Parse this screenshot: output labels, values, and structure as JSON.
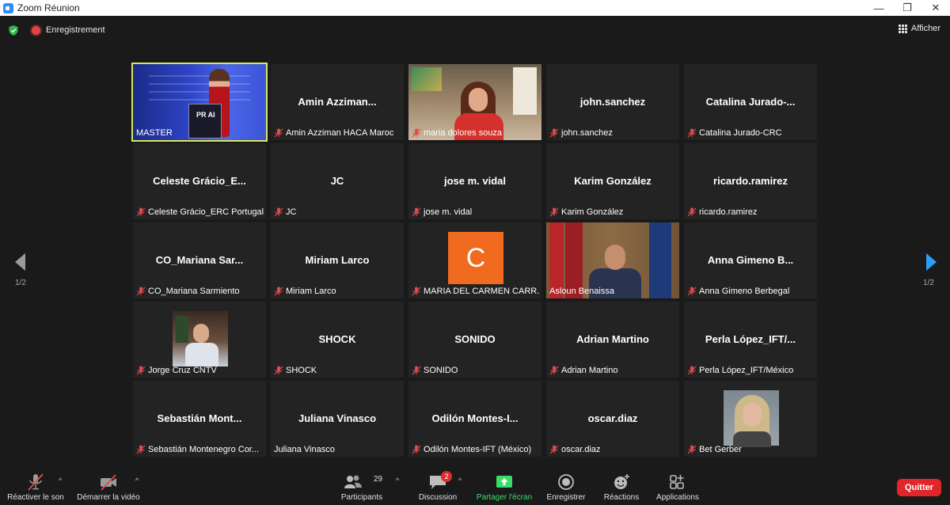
{
  "window": {
    "title": "Zoom Réunion",
    "controls": [
      "—",
      "❐",
      "✕"
    ]
  },
  "topbar": {
    "recording_label": "Enregistrement",
    "view_label": "Afficher"
  },
  "gallery": {
    "page_indicator_left": "1/2",
    "page_indicator_right": "1/2",
    "tiles": [
      {
        "big": "",
        "caption": "MASTER"
      },
      {
        "big": "Amin  Azziman...",
        "caption": "Amin Azziman HACA Maroc"
      },
      {
        "big": "",
        "caption": "maria dolores souza"
      },
      {
        "big": "john.sanchez",
        "caption": "john.sanchez"
      },
      {
        "big": "Catalina  Jurado-...",
        "caption": "Catalina Jurado-CRC"
      },
      {
        "big": "Celeste  Grácio_E...",
        "caption": "Celeste Grácio_ERC Portugal"
      },
      {
        "big": "JC",
        "caption": "JC"
      },
      {
        "big": "jose m. vidal",
        "caption": "jose m. vidal"
      },
      {
        "big": "Karim González",
        "caption": "Karim González"
      },
      {
        "big": "ricardo.ramirez",
        "caption": "ricardo.ramirez"
      },
      {
        "big": "CO_Mariana  Sar...",
        "caption": "CO_Mariana Sarmiento"
      },
      {
        "big": "Miriam Larco",
        "caption": "Miriam Larco"
      },
      {
        "big": "",
        "caption": "MARIA DEL CARMEN CARR..."
      },
      {
        "big": "",
        "caption": "Asloun Benaissa"
      },
      {
        "big": "Anna Gimeno B...",
        "caption": "Anna Gimeno Berbegal"
      },
      {
        "big": "",
        "caption": "Jorge Cruz CNTV"
      },
      {
        "big": "SHOCK",
        "caption": "SHOCK"
      },
      {
        "big": "SONIDO",
        "caption": "SONIDO"
      },
      {
        "big": "Adrian Martino",
        "caption": "Adrian Martino"
      },
      {
        "big": "Perla  López_IFT/...",
        "caption": "Perla López_IFT/México"
      },
      {
        "big": "Sebastián  Mont...",
        "caption": "Sebastián Montenegro Cor..."
      },
      {
        "big": "Juliana Vinasco",
        "caption": "Juliana Vinasco"
      },
      {
        "big": "Odilón  Montes-I...",
        "caption": "Odilón Montes-IFT (México)"
      },
      {
        "big": "oscar.diaz",
        "caption": "oscar.diaz"
      },
      {
        "big": "",
        "caption": "Bet Gerber"
      }
    ],
    "avatar_letter": "C",
    "master_podium_text": "PR AI"
  },
  "toolbar": {
    "unmute_label": "Réactiver le son",
    "start_video_label": "Démarrer la vidéo",
    "participants_label": "Participants",
    "participants_count": "29",
    "chat_label": "Discussion",
    "chat_badge": "2",
    "share_label": "Partager l'écran",
    "record_label": "Enregistrer",
    "reactions_label": "Réactions",
    "apps_label": "Applications",
    "quit_label": "Quitter",
    "caret": "^"
  },
  "colors": {
    "share_green": "#3ddc6a",
    "quit_red": "#e0262a",
    "active_speaker_border": "#d8e85a",
    "nav_arrow_blue": "#2d9cff",
    "muted_red": "#e24a4a"
  }
}
